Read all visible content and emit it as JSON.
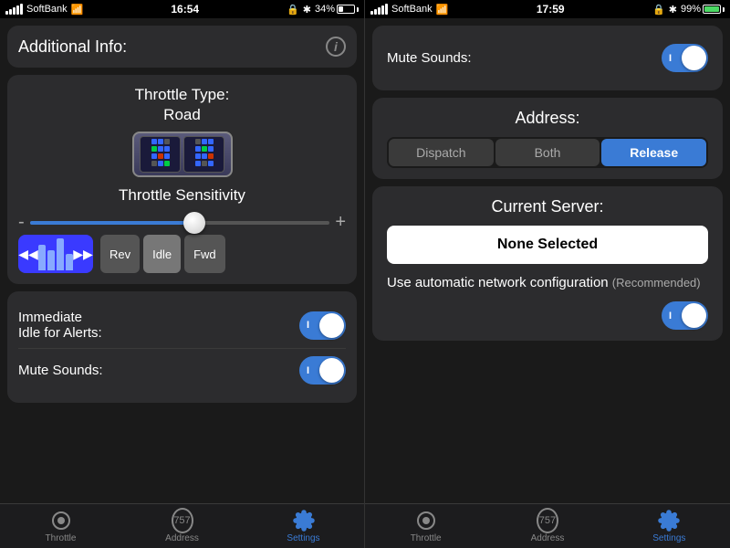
{
  "left": {
    "statusBar": {
      "carrier": "SoftBank",
      "time": "16:54",
      "battery": "34%"
    },
    "additionalInfo": {
      "title": "Additional Info:",
      "infoIconLabel": "i"
    },
    "throttleType": {
      "label": "Throttle Type:",
      "value": "Road"
    },
    "sensitivity": {
      "label": "Throttle Sensitivity",
      "minus": "-",
      "plus": "+"
    },
    "directionButtons": {
      "rev": "Rev",
      "idle": "Idle",
      "fwd": "Fwd"
    },
    "immediateIdle": {
      "label": "Immediate\nIdle for Alerts:",
      "toggleState": "on"
    },
    "muteSounds": {
      "label": "Mute Sounds:",
      "toggleState": "on"
    },
    "tabs": [
      {
        "id": "throttle",
        "label": "Throttle",
        "active": false
      },
      {
        "id": "address",
        "label": "Address",
        "active": false
      },
      {
        "id": "settings",
        "label": "Settings",
        "active": true
      }
    ]
  },
  "right": {
    "statusBar": {
      "carrier": "SoftBank",
      "time": "17:59",
      "battery": "99%"
    },
    "muteSounds": {
      "label": "Mute Sounds:",
      "toggleState": "on"
    },
    "address": {
      "title": "Address:",
      "segments": [
        {
          "id": "dispatch",
          "label": "Dispatch",
          "active": false
        },
        {
          "id": "both",
          "label": "Both",
          "active": false
        },
        {
          "id": "release",
          "label": "Release",
          "active": true
        }
      ]
    },
    "currentServer": {
      "title": "Current Server:",
      "noneSelected": "None Selected",
      "autoConfigLabel": "Use automatic network configuration",
      "recommended": "(Recommended)",
      "toggleState": "on"
    },
    "tabs": [
      {
        "id": "throttle",
        "label": "Throttle",
        "active": false
      },
      {
        "id": "address",
        "label": "Address",
        "active": false
      },
      {
        "id": "settings",
        "label": "Settings",
        "active": true
      }
    ]
  }
}
